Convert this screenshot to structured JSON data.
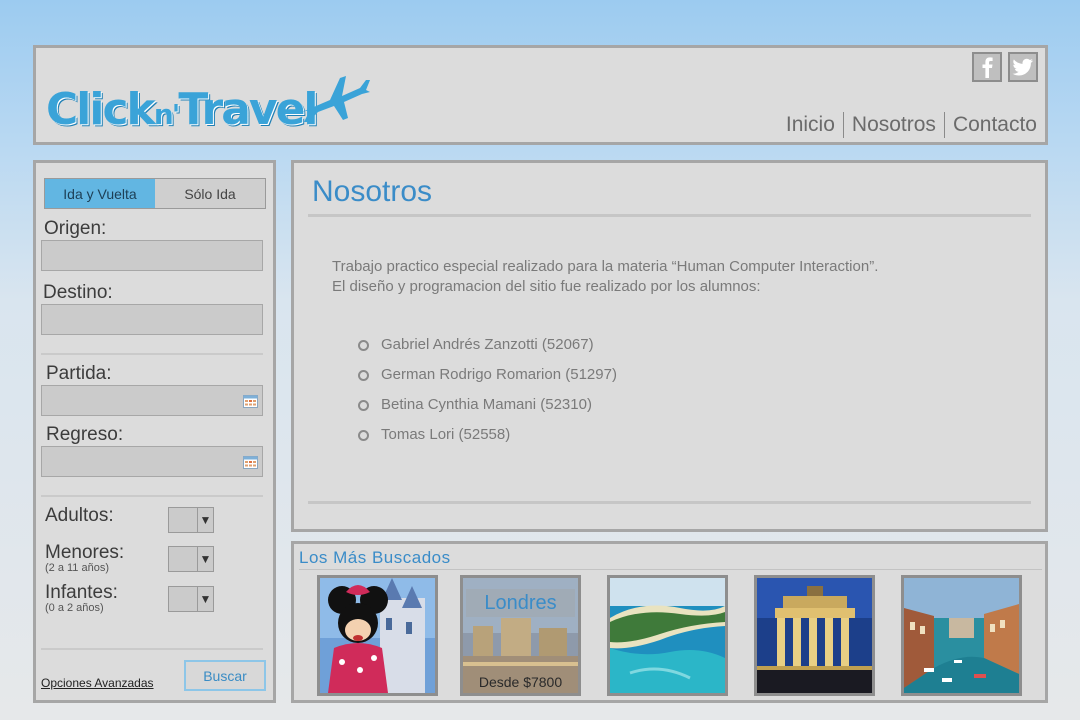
{
  "header": {
    "logo_text": "Click n'Travel",
    "social": [
      {
        "name": "facebook",
        "icon": "facebook-icon"
      },
      {
        "name": "twitter",
        "icon": "twitter-icon"
      }
    ],
    "nav": [
      "Inicio",
      "Nosotros",
      "Contacto"
    ]
  },
  "search_form": {
    "tabs": [
      "Ida y Vuelta",
      "Sólo Ida"
    ],
    "active_tab": "Ida y Vuelta",
    "origin_label": "Origen:",
    "origin_value": "",
    "destination_label": "Destino:",
    "destination_value": "",
    "departure_label": "Partida:",
    "return_label": "Regreso:",
    "adults_label": "Adultos:",
    "minors_label": "Menores:",
    "minors_sub": "(2 a 11 años)",
    "infants_label": "Infantes:",
    "infants_sub": "(0 a 2 años)",
    "advanced_link": "Opciones Avanzadas",
    "search_button": "Buscar"
  },
  "main": {
    "title": "Nosotros",
    "intro_line1": "Trabajo practico especial realizado para la materia “Human Computer Interaction”.",
    "intro_line2": "El diseño y programacion del sitio fue realizado por los alumnos:",
    "authors": [
      "Gabriel Andrés Zanzotti (52067)",
      "German Rodrigo Romarion (51297)",
      "Betina Cynthia Mamani (52310)",
      "Tomas Lori (52558)"
    ]
  },
  "popular": {
    "title": "Los Más Buscados",
    "featured_destination": "Londres",
    "featured_price": "Desde $7800"
  },
  "colors": {
    "accent": "#3a8cc8",
    "tab_active": "#62b6e2",
    "panel_bg": "#dcdcdc",
    "panel_border": "#a6a6a6"
  }
}
